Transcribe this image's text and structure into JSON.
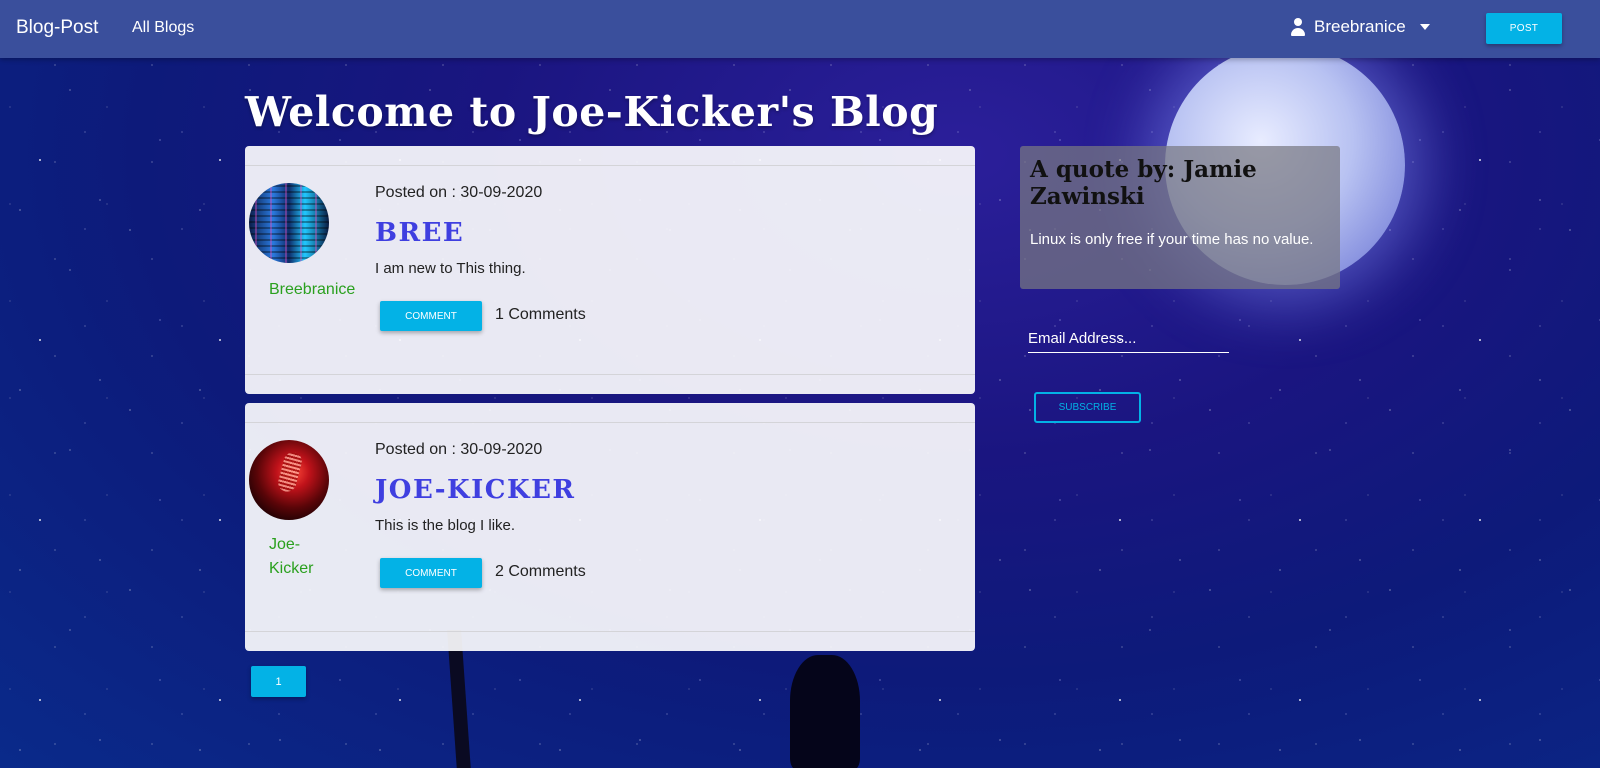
{
  "navbar": {
    "brand": "Blog-Post",
    "all_blogs_link": "All Blogs",
    "username": "Breebranice",
    "post_button": "POST"
  },
  "main": {
    "title": "Welcome to Joe-Kicker's Blog",
    "posts": [
      {
        "posted_on": "Posted on : 30-09-2020",
        "title": "BREE",
        "body": "I am new to This thing.",
        "author": "Breebranice",
        "comment_button": "COMMENT",
        "comment_count": "1 Comments",
        "avatar": "code-screen-avatar"
      },
      {
        "posted_on": "Posted on : 30-09-2020",
        "title": "JOE-KICKER",
        "body": "This is the blog I like.",
        "author": "Joe-\nKicker",
        "comment_button": "COMMENT",
        "comment_count": "2 Comments",
        "avatar": "microphone-avatar"
      }
    ],
    "pagination": {
      "current_page": "1"
    }
  },
  "sidebar": {
    "quote_title": "A quote by: Jamie Zawinski",
    "quote_text": "Linux is only free if your time has no value.",
    "email_placeholder": "Email Address...",
    "subscribe_button": "SUBSCRIBE"
  },
  "colors": {
    "navbar_bg": "#3a4f9c",
    "accent_button": "#03b2e6",
    "post_title": "#3f3fe0",
    "author_link": "#2aa01e"
  }
}
